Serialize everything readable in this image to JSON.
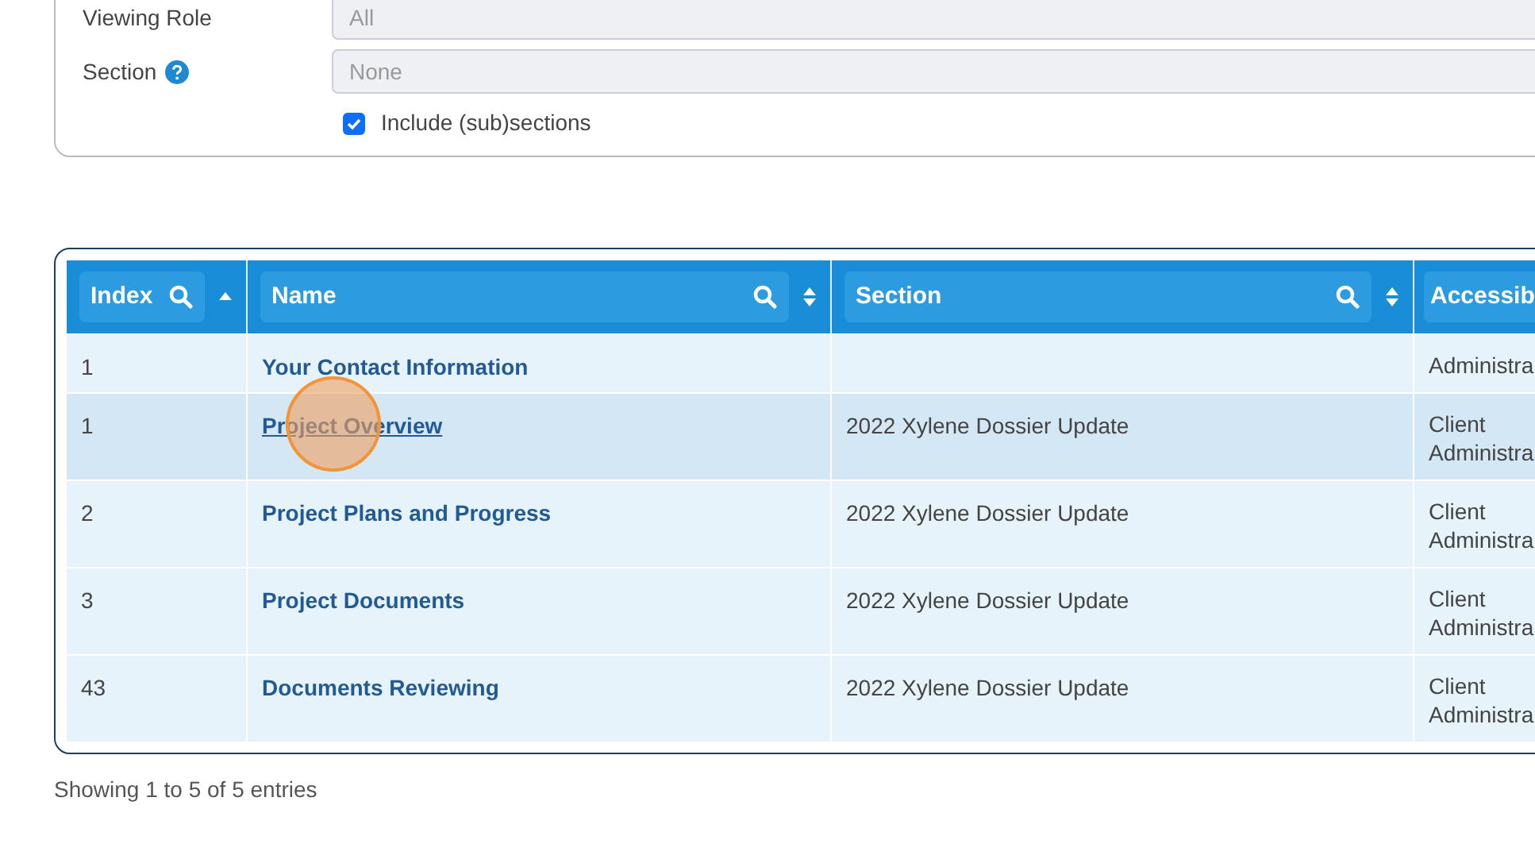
{
  "filters": [
    {
      "label": "Viewing Role",
      "help": false,
      "placeholder": "All"
    },
    {
      "label": "Section",
      "help": true,
      "placeholder": "None"
    }
  ],
  "include_subsections": {
    "label": "Include (sub)sections",
    "checked": true
  },
  "table": {
    "columns": [
      {
        "label": "Index",
        "search": true,
        "sorted": true
      },
      {
        "label": "Name",
        "search": true,
        "sorted": false
      },
      {
        "label": "Section",
        "search": true,
        "sorted": false
      },
      {
        "label": "Accessib"
      }
    ],
    "rows": [
      {
        "index": "1",
        "name": "Your Contact Information",
        "section": "",
        "access": [
          "Administra"
        ],
        "selected": false,
        "hovered": false
      },
      {
        "index": "1",
        "name": "Project Overview",
        "section": "2022 Xylene Dossier Update",
        "access": [
          "Client",
          "Administra"
        ],
        "selected": true,
        "hovered": true
      },
      {
        "index": "2",
        "name": "Project Plans and Progress",
        "section": "2022 Xylene Dossier Update",
        "access": [
          "Client",
          "Administra"
        ],
        "selected": false,
        "hovered": false
      },
      {
        "index": "3",
        "name": "Project Documents",
        "section": "2022 Xylene Dossier Update",
        "access": [
          "Client",
          "Administra"
        ],
        "selected": false,
        "hovered": false
      },
      {
        "index": "43",
        "name": "Documents Reviewing",
        "section": "2022 Xylene Dossier Update",
        "access": [
          "Client",
          "Administra"
        ],
        "selected": false,
        "hovered": false
      }
    ]
  },
  "footer": "Showing 1 to 5 of 5 entries"
}
